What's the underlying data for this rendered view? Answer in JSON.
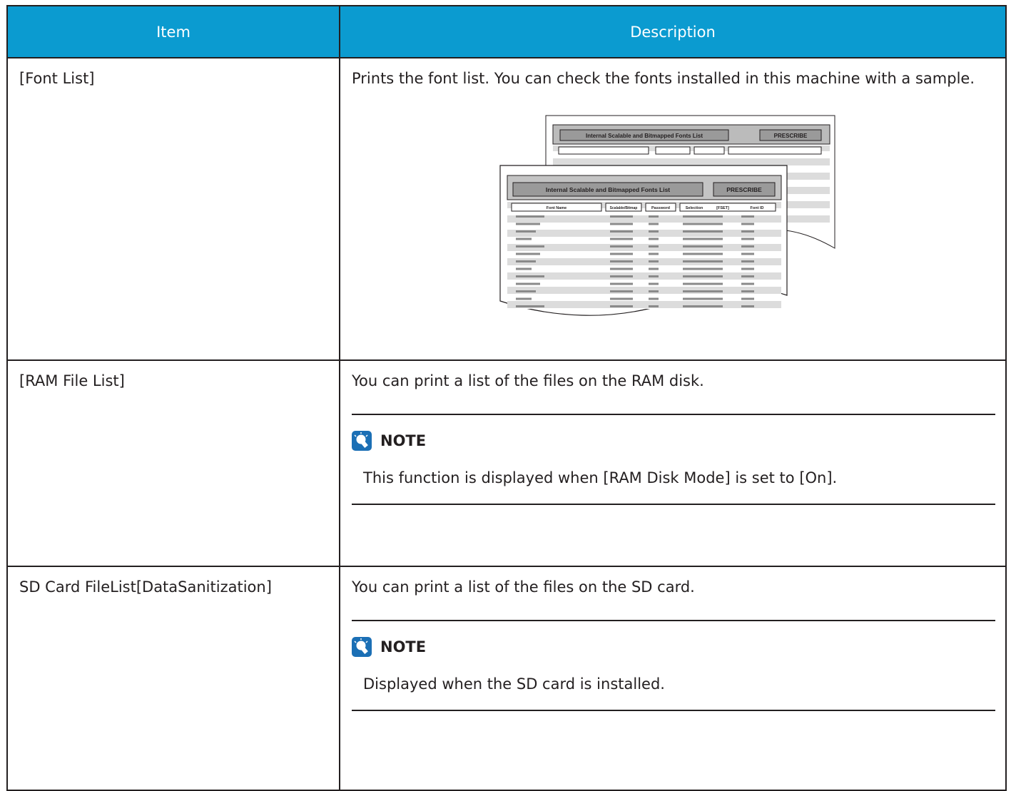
{
  "table": {
    "headers": {
      "item": "Item",
      "description": "Description"
    },
    "rows": [
      {
        "item": "[Font List]",
        "description": "Prints the font list. You can check the fonts installed in this machine with a sample.",
        "figure": {
          "title": "Internal Scalable and Bitmapped Fonts List",
          "badge": "PRESCRIBE",
          "columns": [
            "Font Name",
            "Scalable/Bitmap",
            "Password",
            "Selection",
            "[FSET]",
            "Font ID"
          ]
        }
      },
      {
        "item": "[RAM File List]",
        "description": "You can print a list of the files on the RAM disk.",
        "note": {
          "title": "NOTE",
          "body": "This function is displayed when [RAM Disk Mode] is set to [On]."
        }
      },
      {
        "item": "SD Card FileList[DataSanitization]",
        "description": "You can print a list of the files on the SD card.",
        "note": {
          "title": "NOTE",
          "body": "Displayed when the SD card is installed."
        }
      }
    ]
  },
  "colors": {
    "header_bg": "#0b9bd0",
    "header_text": "#ffffff",
    "border": "#231f20",
    "icon": "#1b6fb5"
  }
}
